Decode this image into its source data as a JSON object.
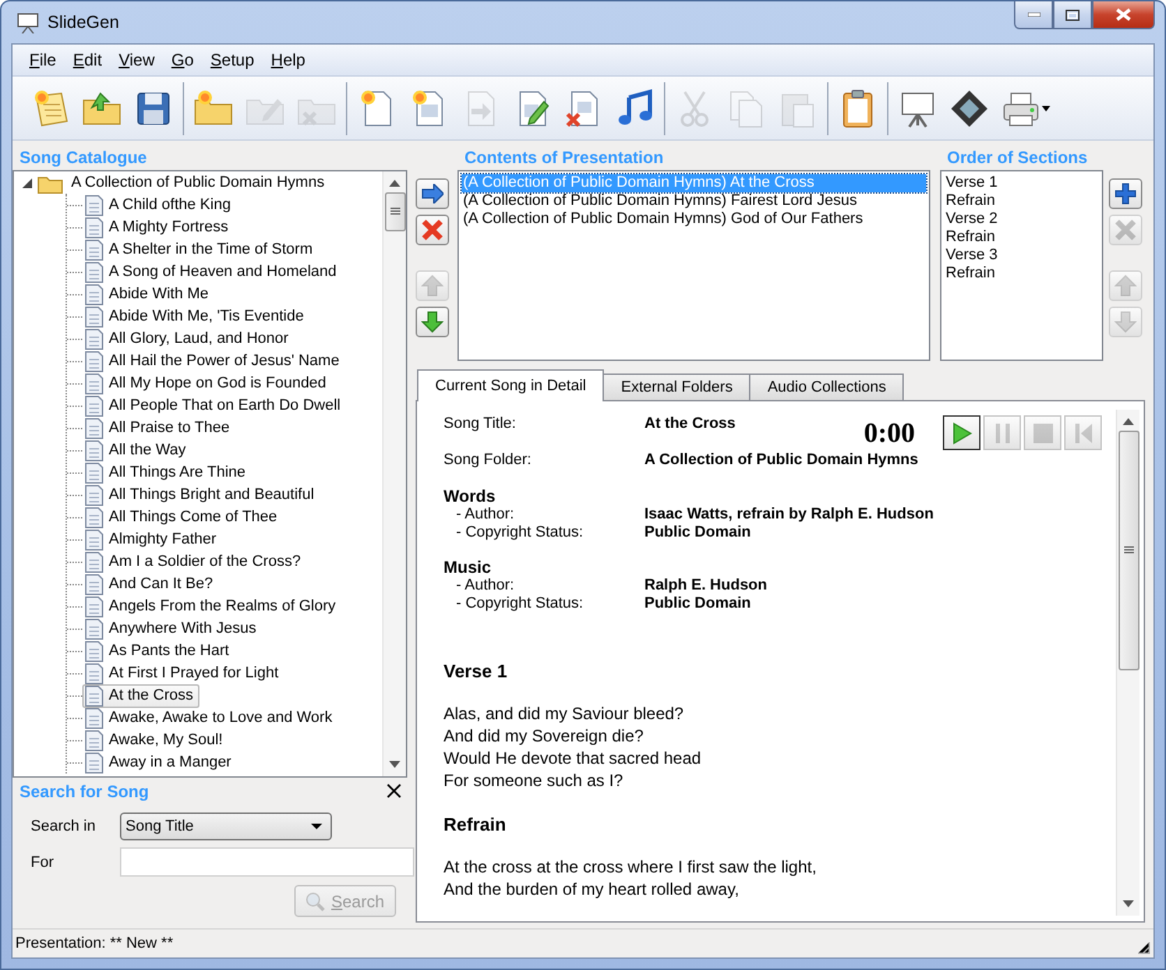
{
  "window": {
    "title": "SlideGen"
  },
  "menu": [
    "File",
    "Edit",
    "View",
    "Go",
    "Setup",
    "Help"
  ],
  "toolbar": [
    {
      "items": [
        {
          "kind": "new-list",
          "disabled": false
        },
        {
          "kind": "open-folder",
          "disabled": false
        },
        {
          "kind": "save",
          "disabled": false
        }
      ]
    },
    {
      "items": [
        {
          "kind": "new-folder",
          "disabled": false
        },
        {
          "kind": "edit-folder",
          "disabled": true
        },
        {
          "kind": "delete-folder",
          "disabled": true
        }
      ]
    },
    {
      "items": [
        {
          "kind": "new-doc",
          "disabled": false
        },
        {
          "kind": "new-slide",
          "disabled": false
        },
        {
          "kind": "import-doc",
          "disabled": true
        },
        {
          "kind": "edit-doc",
          "disabled": false
        },
        {
          "kind": "delete-doc",
          "disabled": false
        },
        {
          "kind": "music",
          "disabled": false
        }
      ]
    },
    {
      "items": [
        {
          "kind": "cut",
          "disabled": true
        },
        {
          "kind": "copy",
          "disabled": true
        },
        {
          "kind": "paste",
          "disabled": true
        }
      ]
    },
    {
      "items": [
        {
          "kind": "clipboard",
          "disabled": false
        }
      ]
    },
    {
      "items": [
        {
          "kind": "easel",
          "disabled": false
        },
        {
          "kind": "film",
          "disabled": false
        },
        {
          "kind": "printer",
          "disabled": false
        }
      ]
    }
  ],
  "catalogue": {
    "title": "Song Catalogue",
    "root": {
      "label": "A Collection of Public Domain Hymns",
      "expanded": true,
      "children": [
        {
          "label": "A Child ofthe King",
          "selected": false
        },
        {
          "label": "A Mighty Fortress",
          "selected": false
        },
        {
          "label": "A Shelter in the Time of Storm",
          "selected": false
        },
        {
          "label": "A Song of Heaven and Homeland",
          "selected": false
        },
        {
          "label": "Abide With Me",
          "selected": false
        },
        {
          "label": "Abide With Me, 'Tis Eventide",
          "selected": false
        },
        {
          "label": "All Glory, Laud, and Honor",
          "selected": false
        },
        {
          "label": "All Hail the Power of Jesus' Name",
          "selected": false
        },
        {
          "label": "All My Hope on God is Founded",
          "selected": false
        },
        {
          "label": "All People That on Earth Do Dwell",
          "selected": false
        },
        {
          "label": "All Praise to Thee",
          "selected": false
        },
        {
          "label": "All the Way",
          "selected": false
        },
        {
          "label": "All Things Are Thine",
          "selected": false
        },
        {
          "label": "All Things Bright and Beautiful",
          "selected": false
        },
        {
          "label": "All Things Come of Thee",
          "selected": false
        },
        {
          "label": "Almighty Father",
          "selected": false
        },
        {
          "label": "Am I a Soldier of the Cross?",
          "selected": false
        },
        {
          "label": "And Can It Be?",
          "selected": false
        },
        {
          "label": "Angels From the Realms of Glory",
          "selected": false
        },
        {
          "label": "Anywhere With Jesus",
          "selected": false
        },
        {
          "label": "As Pants the Hart",
          "selected": false
        },
        {
          "label": "At First I Prayed for Light",
          "selected": false
        },
        {
          "label": "At the Cross",
          "selected": true
        },
        {
          "label": "Awake, Awake to Love and Work",
          "selected": false
        },
        {
          "label": "Awake, My Soul!",
          "selected": false
        },
        {
          "label": "Away in a Manger",
          "selected": false
        }
      ]
    }
  },
  "search": {
    "title": "Search for Song",
    "search_in_label": "Search in",
    "search_in_value": "Song Title",
    "for_label": "For",
    "button": {
      "label": "Search",
      "disabled": true
    }
  },
  "contents": {
    "title": "Contents of Presentation",
    "buttons": [
      {
        "kind": "add",
        "disabled": false
      },
      {
        "kind": "remove",
        "disabled": false
      },
      {
        "kind": "up",
        "disabled": true
      },
      {
        "kind": "down",
        "disabled": false
      }
    ],
    "items": [
      {
        "label": "(A Collection of Public Domain Hymns) At the Cross",
        "selected": true
      },
      {
        "label": "(A Collection of Public Domain Hymns) Fairest Lord Jesus",
        "selected": false
      },
      {
        "label": "(A Collection of Public Domain Hymns) God of Our Fathers",
        "selected": false
      }
    ]
  },
  "sections": {
    "title": "Order of Sections",
    "items": [
      "Verse 1",
      "Refrain",
      "Verse 2",
      "Refrain",
      "Verse 3",
      "Refrain"
    ],
    "buttons": [
      {
        "kind": "plus",
        "disabled": false
      },
      {
        "kind": "remove",
        "disabled": true
      },
      {
        "kind": "up",
        "disabled": true
      },
      {
        "kind": "down",
        "disabled": true
      }
    ]
  },
  "tabs": [
    {
      "label": "Current Song in Detail",
      "selected": true
    },
    {
      "label": "External Folders",
      "selected": false
    },
    {
      "label": "Audio Collections",
      "selected": false
    }
  ],
  "details": [
    {
      "kind": "field",
      "label": "Song Title:",
      "value": "At the Cross"
    },
    {
      "kind": "field",
      "label": "Song Folder:",
      "value": "A Collection of Public Domain Hymns"
    },
    {
      "kind": "group",
      "heading": "Words",
      "rows": [
        {
          "label": "- Author:",
          "value": "Isaac Watts, refrain by Ralph E. Hudson"
        },
        {
          "label": "- Copyright Status:",
          "value": "Public Domain"
        }
      ]
    },
    {
      "kind": "group",
      "heading": "Music",
      "rows": [
        {
          "label": "- Author:",
          "value": "Ralph E. Hudson"
        },
        {
          "label": "- Copyright Status:",
          "value": "Public Domain"
        }
      ]
    }
  ],
  "player": {
    "time": "0:00",
    "buttons": [
      {
        "kind": "play",
        "disabled": false
      },
      {
        "kind": "pause",
        "disabled": true
      },
      {
        "kind": "stop",
        "disabled": true
      },
      {
        "kind": "rewind",
        "disabled": true
      }
    ]
  },
  "lyrics": [
    {
      "heading": "Verse 1",
      "lines": [
        "Alas, and did my Saviour bleed?",
        "And did my Sovereign die?",
        "Would He devote that sacred head",
        "For someone such as I?"
      ]
    },
    {
      "heading": "Refrain",
      "lines": [
        "At the cross at the cross where I first saw the light,",
        "And the burden of my heart rolled away,"
      ]
    }
  ],
  "status_bar": "Presentation: ** New **"
}
